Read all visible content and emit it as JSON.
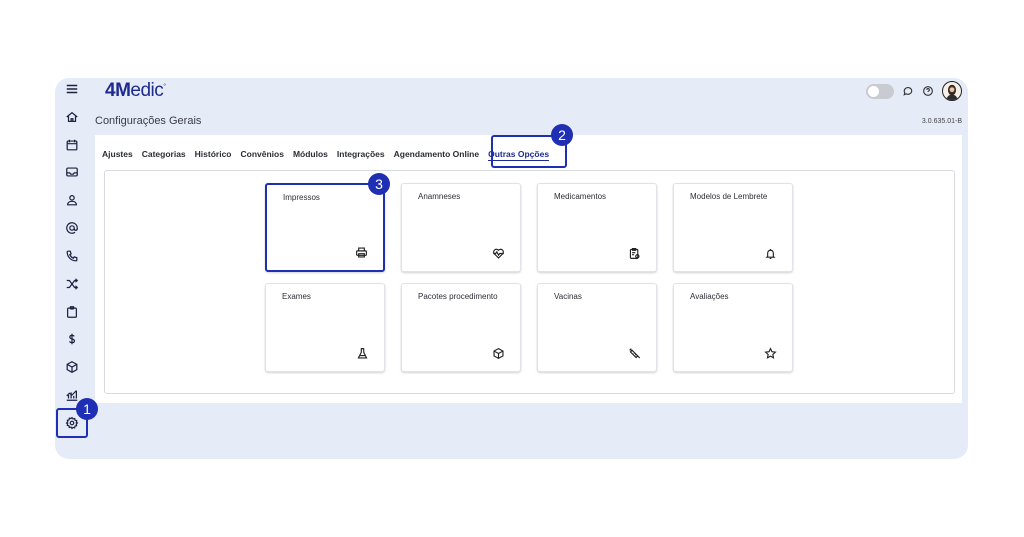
{
  "app": {
    "logo": {
      "main": "4M",
      "rest": "edic",
      "mark": "°"
    },
    "page_title": "Configurações Gerais",
    "version": "3.0.635.01-B"
  },
  "sidebar": {
    "items": [
      {
        "name": "menu",
        "icon": "menu-icon"
      },
      {
        "name": "home",
        "icon": "home-icon"
      },
      {
        "name": "calendar",
        "icon": "calendar-icon"
      },
      {
        "name": "inbox",
        "icon": "inbox-icon"
      },
      {
        "name": "patients",
        "icon": "person-icon"
      },
      {
        "name": "email",
        "icon": "at-icon"
      },
      {
        "name": "phone",
        "icon": "phone-icon"
      },
      {
        "name": "shuffle",
        "icon": "shuffle-icon"
      },
      {
        "name": "clipboard",
        "icon": "clipboard-icon"
      },
      {
        "name": "finance",
        "icon": "dollar-icon"
      },
      {
        "name": "packages",
        "icon": "cube-icon"
      },
      {
        "name": "reports",
        "icon": "chart-icon"
      },
      {
        "name": "settings",
        "icon": "gear-icon"
      }
    ]
  },
  "tabs": [
    {
      "label": "Ajustes",
      "active": false
    },
    {
      "label": "Categorias",
      "active": false
    },
    {
      "label": "Histórico",
      "active": false
    },
    {
      "label": "Convênios",
      "active": false
    },
    {
      "label": "Módulos",
      "active": false
    },
    {
      "label": "Integrações",
      "active": false
    },
    {
      "label": "Agendamento Online",
      "active": false
    },
    {
      "label": "Outras Opções",
      "active": true
    }
  ],
  "cards": [
    {
      "label": "Impressos",
      "icon": "printer-icon",
      "highlighted": true
    },
    {
      "label": "Anamneses",
      "icon": "heartbeat-icon"
    },
    {
      "label": "Medicamentos",
      "icon": "prescription-icon"
    },
    {
      "label": "Modelos de Lembrete",
      "icon": "bell-icon"
    },
    {
      "label": "Exames",
      "icon": "flask-icon"
    },
    {
      "label": "Pacotes procedimento",
      "icon": "package-icon"
    },
    {
      "label": "Vacinas",
      "icon": "syringe-icon"
    },
    {
      "label": "Avaliações",
      "icon": "star-icon"
    }
  ],
  "step_badges": [
    "1",
    "2",
    "3"
  ],
  "colors": {
    "accent": "#1f2fb3",
    "brand": "#1e2b8f",
    "frame_bg": "#e6ebf8"
  }
}
